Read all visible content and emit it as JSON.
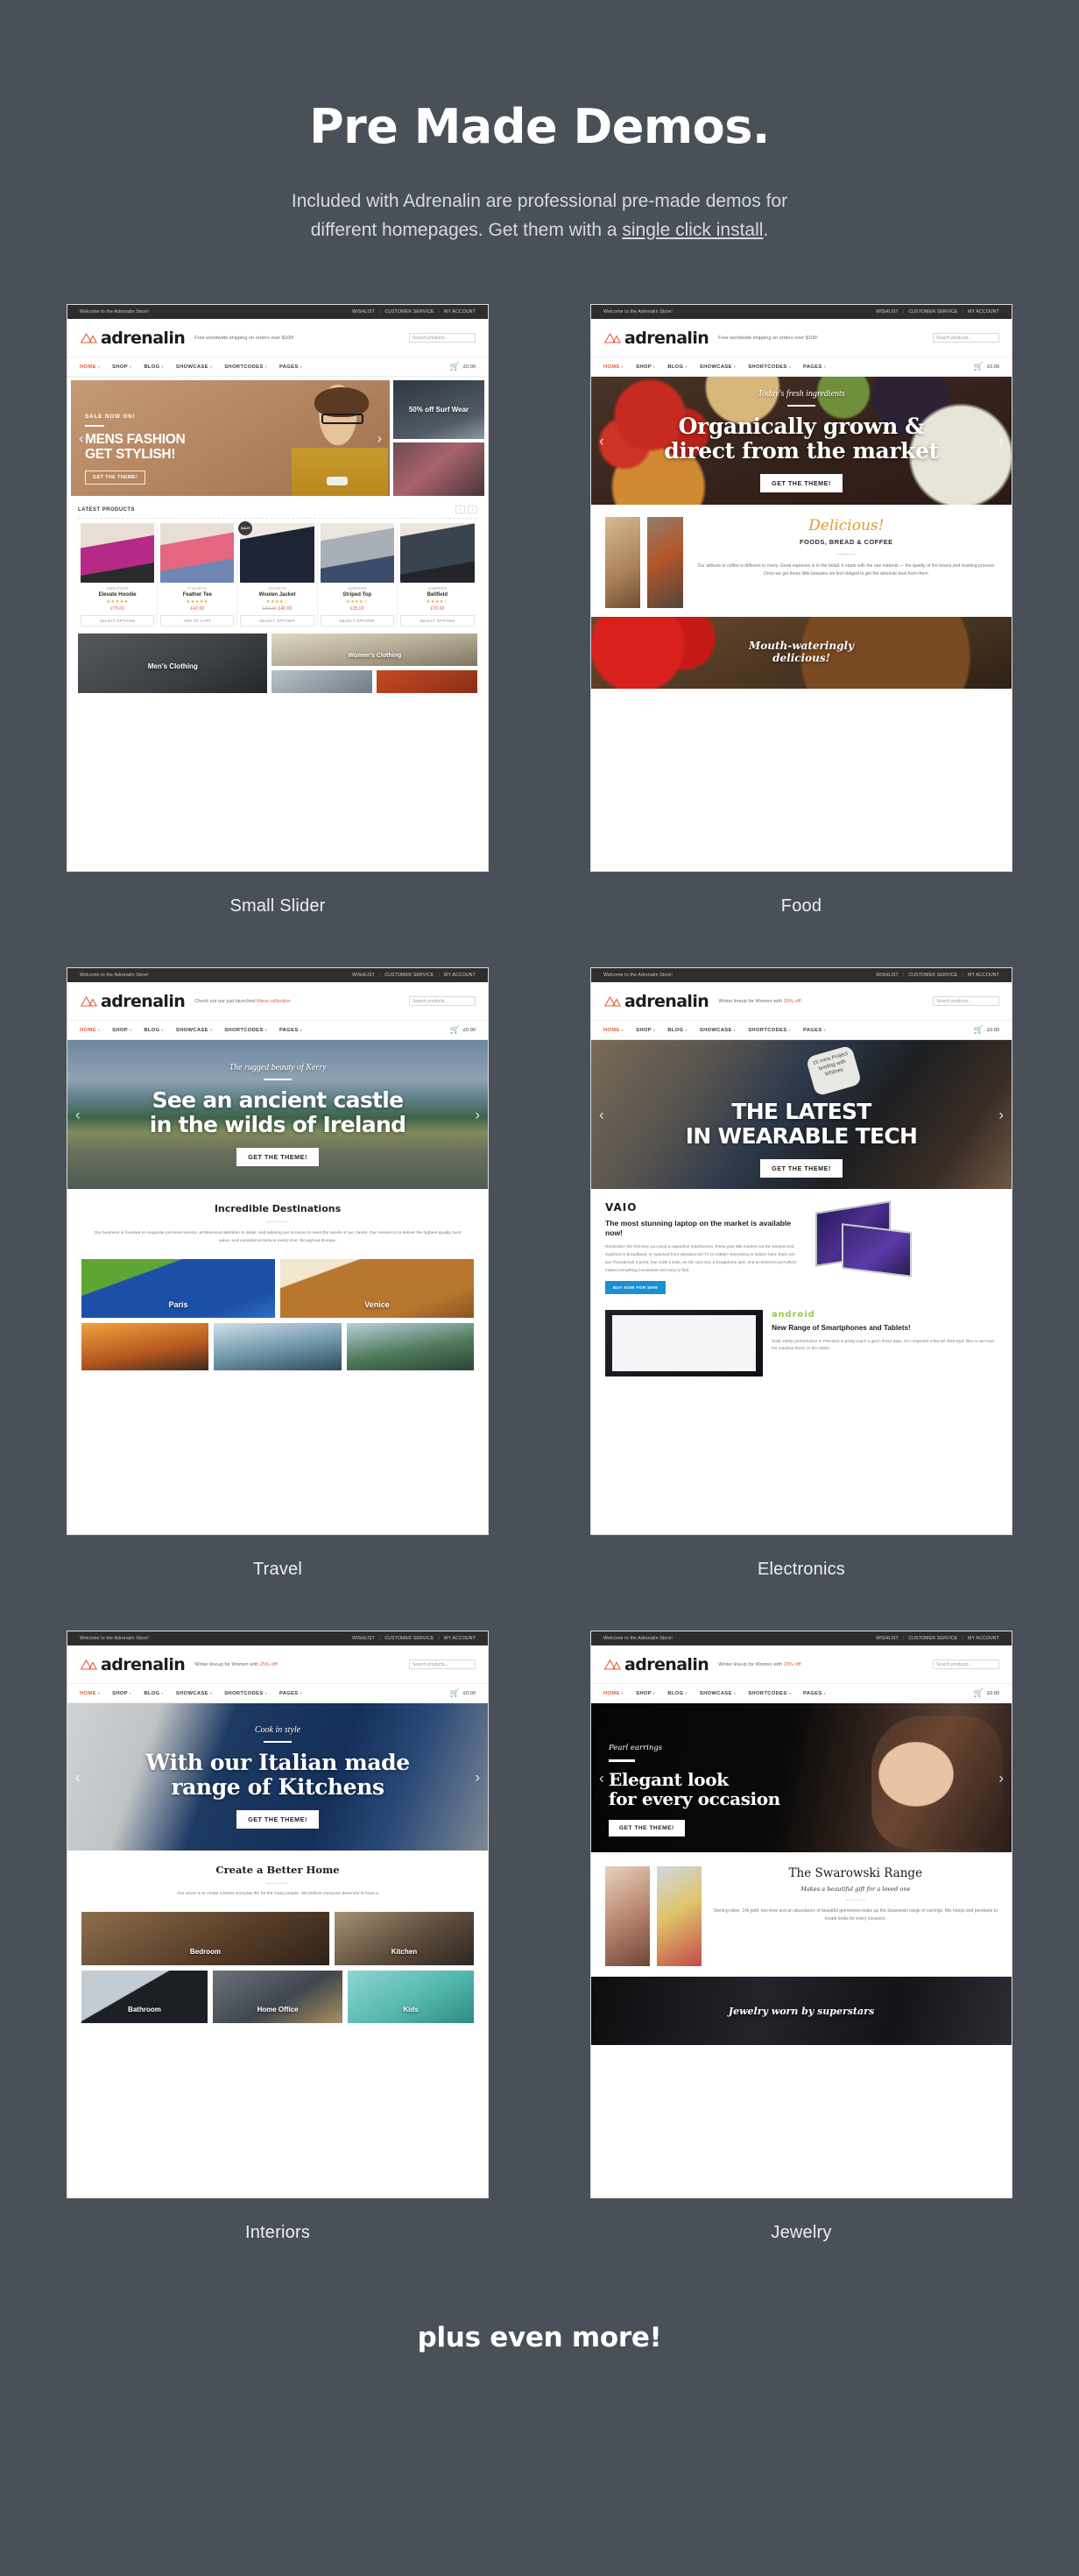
{
  "page": {
    "title": "Pre Made Demos.",
    "subtitle_line1": "Included with Adrenalin are professional pre-made demos for",
    "subtitle_line2_pre": "different homepages. Get them with a ",
    "subtitle_link": "single click install",
    "subtitle_line2_post": ".",
    "footer_text": "plus even more!",
    "bg_color": "#4a5058",
    "accent_color": "#e8593a"
  },
  "chrome": {
    "topbar_welcome": "Welcome to the Adrenalin Store!",
    "topbar_links": [
      "WISHLIST",
      "CUSTOMER SERVICE",
      "MY ACCOUNT"
    ],
    "logo_text": "adrenalin",
    "search_placeholder": "Search products...",
    "nav_items": [
      "HOME",
      "SHOP",
      "BLOG",
      "SHOWCASE",
      "SHORTCODES",
      "PAGES"
    ],
    "cart_total": "£0.00",
    "cart_count": "0",
    "taglines": {
      "shipping": "Free worldwide shipping on orders over $100!",
      "mens": "Check out our just launched ",
      "mens_link": "Mens collection",
      "winter": "Winter lineup for Women with ",
      "winter_link": "25% off!"
    }
  },
  "demos": [
    {
      "caption": "Small Slider",
      "hero": {
        "kicker": "SALE NOW ON!",
        "headline_line1": "MENS FASHION",
        "headline_line2": "GET STYLISH!",
        "cta": "GET THE THEME!"
      },
      "side_promo": "50% off Surf Wear",
      "products_heading": "LATEST PRODUCTS",
      "products": [
        {
          "category": "SWEATERS",
          "name": "Elevate Hoodie",
          "stars": "★★★★★",
          "price": "£79.00",
          "old_price": "",
          "button": "SELECT OPTIONS",
          "badge": ""
        },
        {
          "category": "T-SHIRTS",
          "name": "Feather Tee",
          "stars": "★★★★★",
          "price": "£42.00",
          "old_price": "",
          "button": "ADD TO CART",
          "badge": ""
        },
        {
          "category": "JACKETS",
          "name": "Woolen Jacket",
          "stars": "★★★★☆",
          "price": "£40.00",
          "old_price": "£80.00",
          "button": "SELECT OPTIONS",
          "badge": "SALE!"
        },
        {
          "category": "JUMPERS",
          "name": "Striped Top",
          "stars": "★★★★☆",
          "price": "£35.00",
          "old_price": "",
          "button": "SELECT OPTIONS",
          "badge": ""
        },
        {
          "category": "JUMPERS",
          "name": "Bellfield",
          "stars": "★★★★☆",
          "price": "£70.00",
          "old_price": "",
          "button": "SELECT OPTIONS",
          "badge": ""
        }
      ],
      "category_tiles": [
        "Men's Clothing",
        "Women's Clothing"
      ]
    },
    {
      "caption": "Food",
      "hero": {
        "kicker": "Today's fresh ingredients",
        "headline_line1": "Organically grown &",
        "headline_line2": "direct from the market",
        "cta": "GET THE THEME!"
      },
      "section": {
        "title": "Delicious!",
        "subtitle": "FOODS, BREAD & COFFEE",
        "body": "Our attitude to coffee is different to many. Great espresso is in the detail. It starts with the raw material — the quality of the beans and roasting process. Once we get these little beauties we feel obliged to get the absolute best from them."
      },
      "bottom_banner_line1": "Mouth-wateringly",
      "bottom_banner_line2": "delicious!"
    },
    {
      "caption": "Travel",
      "hero": {
        "kicker": "The rugged beauty of Kerry",
        "headline_line1": "See an ancient castle",
        "headline_line2": "in the wilds of Ireland",
        "cta": "GET THE THEME!"
      },
      "section": {
        "title": "Incredible Destinations",
        "body": "Our business is founded on exquisite personal service, professional attention to detail, and tailoring our services to meet the needs of our clients. Our mission is to deliver the highest quality, best value, and exceptional service every time, throughout Europe."
      },
      "destinations": [
        "Paris",
        "Venice"
      ]
    },
    {
      "caption": "Electronics",
      "hero": {
        "kicker": "",
        "headline_line1": "THE LATEST",
        "headline_line2": "IN WEARABLE TECH",
        "cta": "GET THE THEME!"
      },
      "watch_text": "15 mins Project briefing with Whitney",
      "vaio": {
        "brand": "VAIO",
        "title": "The most stunning laptop on the market is available now!",
        "body": "Remember the first time you used a capacitive touchscreen, threw your 56k modem out the window and switched to broadband, or switched from standard-def TV to 1080p? Everything is hidden here: there are two Thunderbolt 2 ports, four USB 3 slots, an SD card slot, a headphone jack, and an Ethernet port which makes everything convenient and easy to find.",
        "button": "BUY NOW FOR $999"
      },
      "android": {
        "brand": "android",
        "title": "New Range of Smartphones and Tablets!",
        "body": "Solid 1080p performance in Premiere is pretty much a given these days. So I imported a few 5K RED Epic files to see how the machine fared. In the native"
      }
    },
    {
      "caption": "Interiors",
      "hero": {
        "kicker": "Cook in style",
        "headline_line1": "With our Italian made",
        "headline_line2": "range of Kitchens",
        "cta": "GET THE THEME!"
      },
      "section": {
        "title": "Create a Better Home",
        "body": "Our vision is to create a better everyday life for the many people. We believe everyone deserves to have a"
      },
      "rooms": [
        "Bedroom",
        "Kitchen",
        "Bathroom",
        "Home Office",
        "Kids"
      ]
    },
    {
      "caption": "Jewelry",
      "hero": {
        "kicker": "Pearl earrings",
        "headline_line1": "Elegant look",
        "headline_line2": "for every occasion",
        "cta": "GET THE THEME!"
      },
      "section": {
        "title": "The Swarowski Range",
        "subtitle": "Makes a beautiful gift for a loved one",
        "body": "Sterling silver, 14k gold, two-tone and an abundance of beautiful gemstones make up the Swarowski range of earrings. Mix hoops and pendants to create looks for every occasion."
      },
      "bottom_banner": "Jewelry worn by superstars"
    }
  ]
}
